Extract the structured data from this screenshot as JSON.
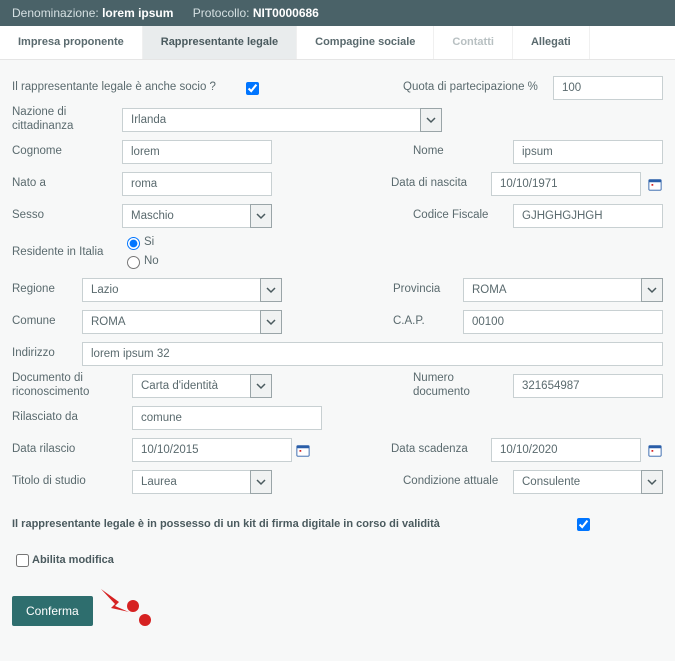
{
  "header": {
    "denom_label": "Denominazione:",
    "denom_value": "lorem ipsum",
    "proto_label": "Protocollo:",
    "proto_value": "NIT0000686"
  },
  "tabs": {
    "t0": "Impresa proponente",
    "t1": "Rappresentante legale",
    "t2": "Compagine sociale",
    "t3": "Contatti",
    "t4": "Allegati"
  },
  "form": {
    "socio_q": "Il rappresentante legale è anche socio ?",
    "quota_label": "Quota di partecipazione %",
    "quota_value": "100",
    "nazione_label": "Nazione di cittadinanza",
    "nazione_value": "Irlanda",
    "cognome_label": "Cognome",
    "cognome_value": "lorem",
    "nome_label": "Nome",
    "nome_value": "ipsum",
    "natoa_label": "Nato a",
    "natoa_value": "roma",
    "datanasc_label": "Data di nascita",
    "datanasc_value": "10/10/1971",
    "sesso_label": "Sesso",
    "sesso_value": "Maschio",
    "cf_label": "Codice Fiscale",
    "cf_value": "GJHGHGJHGH",
    "residente_label": "Residente in Italia",
    "si": "Si",
    "no": "No",
    "regione_label": "Regione",
    "regione_value": "Lazio",
    "provincia_label": "Provincia",
    "provincia_value": "ROMA",
    "comune_label": "Comune",
    "comune_value": "ROMA",
    "cap_label": "C.A.P.",
    "cap_value": "00100",
    "indirizzo_label": "Indirizzo",
    "indirizzo_value": "lorem ipsum 32",
    "docric_label": "Documento di riconoscimento",
    "docric_value": "Carta d'identità",
    "numdoc_label": "Numero documento",
    "numdoc_value": "321654987",
    "rilasciato_label": "Rilasciato da",
    "rilasciato_value": "comune",
    "datarilascio_label": "Data rilascio",
    "datarilascio_value": "10/10/2015",
    "datascad_label": "Data scadenza",
    "datascad_value": "10/10/2020",
    "titolo_label": "Titolo di studio",
    "titolo_value": "Laurea",
    "cond_label": "Condizione attuale",
    "cond_value": "Consulente",
    "firma_q": "Il rappresentante legale è in possesso di un kit di firma digitale in corso di validità",
    "abilita": "Abilita modifica",
    "conferma": "Conferma"
  }
}
